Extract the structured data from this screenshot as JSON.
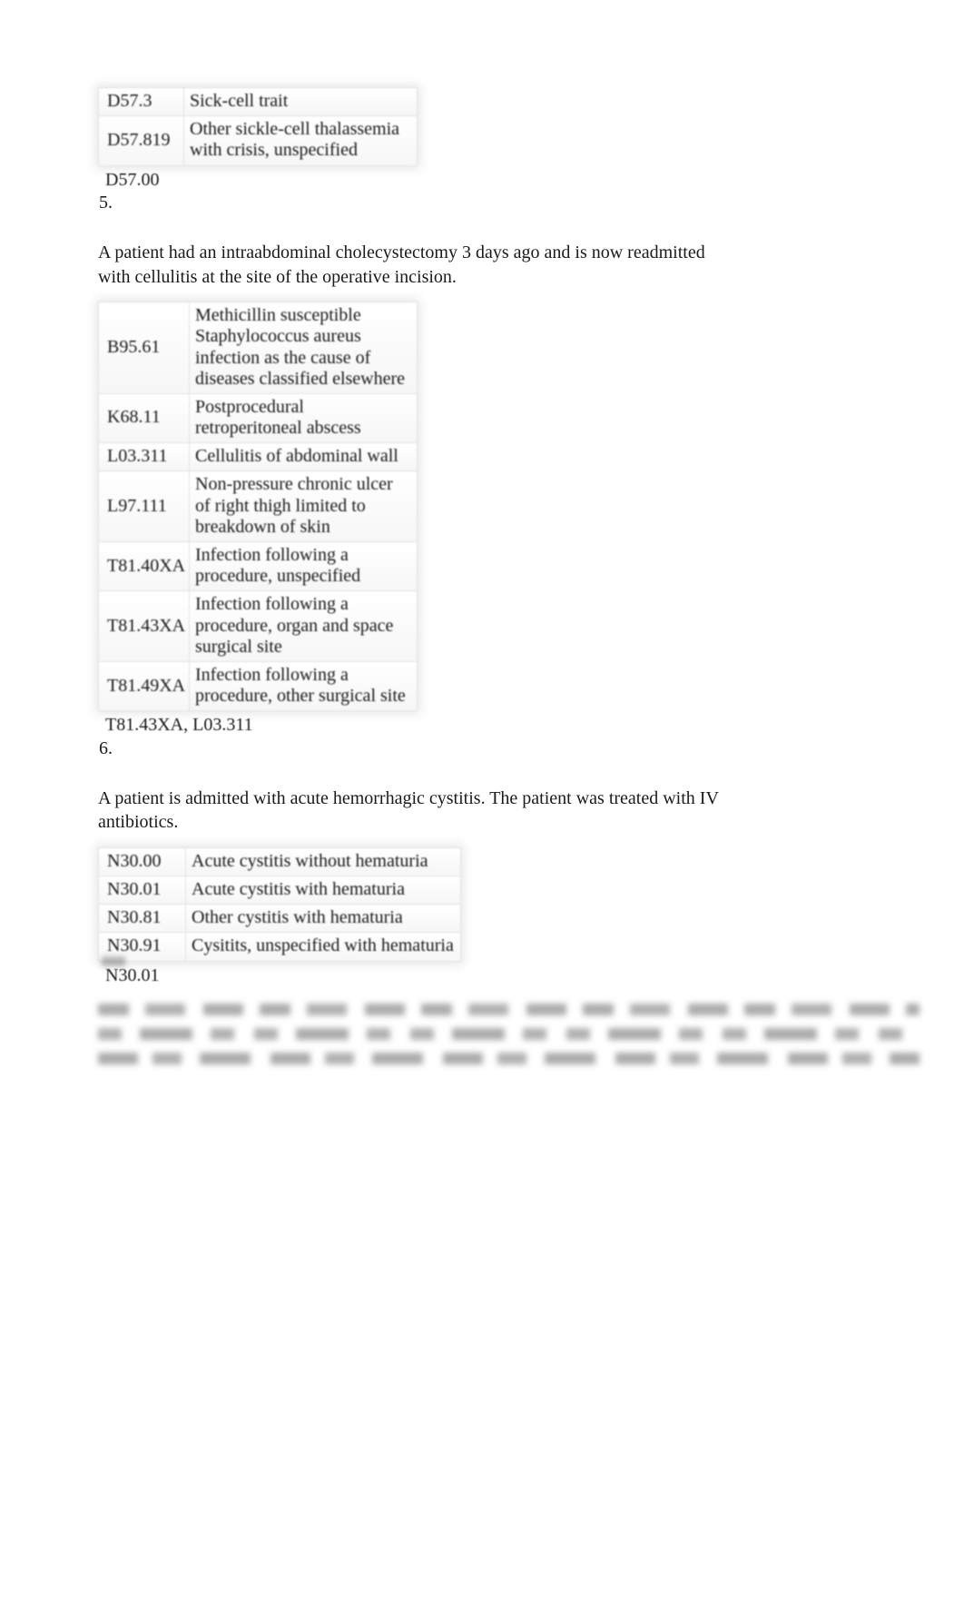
{
  "document": {
    "type": "medical-coding-quiz-worksheet",
    "sections": [
      {
        "id": "section-4-answer",
        "table": {
          "rows": [
            {
              "code": "D57.3",
              "description": "Sick-cell trait"
            },
            {
              "code": "D57.819",
              "description": "Other sickle-cell thalassemia with crisis, unspecified"
            }
          ]
        },
        "answer": "D57.00",
        "question_number": "5."
      },
      {
        "id": "section-5",
        "prompt": "A patient had an intraabdominal cholecystectomy 3 days ago and is now readmitted with cellulitis at the site of the operative incision.",
        "table": {
          "rows": [
            {
              "code": "B95.61",
              "description": "Methicillin susceptible Staphylococcus aureus infection as the cause of diseases classified elsewhere"
            },
            {
              "code": "K68.11",
              "description": "Postprocedural retroperitoneal abscess"
            },
            {
              "code": "L03.311",
              "description": "Cellulitis of abdominal wall"
            },
            {
              "code": "L97.111",
              "description": "Non-pressure chronic ulcer of right thigh limited to breakdown of skin"
            },
            {
              "code": "T81.40XA",
              "description": "Infection following a procedure, unspecified"
            },
            {
              "code": "T81.43XA",
              "description": "Infection following a procedure, organ and space surgical site"
            },
            {
              "code": "T81.49XA",
              "description": "Infection following a procedure, other surgical site"
            }
          ]
        },
        "answer": "T81.43XA, L03.311",
        "question_number": "6."
      },
      {
        "id": "section-6",
        "prompt": "A patient is admitted with acute hemorrhagic cystitis. The patient was treated with IV antibiotics.",
        "table": {
          "rows": [
            {
              "code": "N30.00",
              "description": "Acute cystitis without hematuria"
            },
            {
              "code": "N30.01",
              "description": "Acute cystitis with hematuria"
            },
            {
              "code": "N30.81",
              "description": "Other cystitis with hematuria"
            },
            {
              "code": "N30.91",
              "description": "Cysitits, unspecified with hematuria"
            }
          ]
        },
        "answer": "N30.01",
        "question_number": ""
      }
    ],
    "illegible_footer": {
      "note": "",
      "line_count": 3
    }
  }
}
